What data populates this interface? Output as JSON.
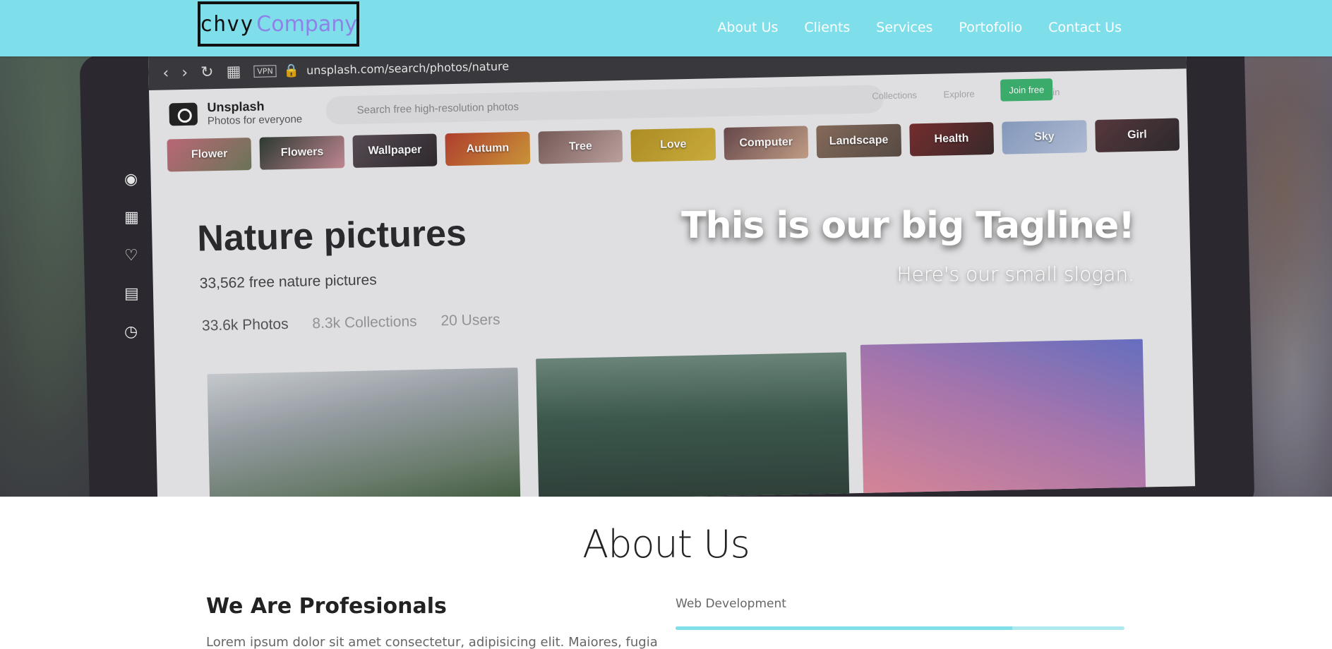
{
  "navbar": {
    "logo": {
      "part1": "chvy",
      "part2": "Company"
    },
    "links": [
      "About Us",
      "Clients",
      "Services",
      "Portofolio",
      "Contact Us"
    ]
  },
  "hero": {
    "tagline": "This is our big Tagline!",
    "slogan": "Here's our small slogan.",
    "screen": {
      "vpn": "VPN",
      "url": "unsplash.com/search/photos/nature",
      "brand": "Unsplash",
      "brand_sub": "Photos for everyone",
      "search_placeholder": "Search free high-resolution photos",
      "top_links": [
        "Collections",
        "Explore",
        "•••",
        "Login"
      ],
      "join": "Join free",
      "chips": [
        "Flower",
        "Flowers",
        "Wallpaper",
        "Autumn",
        "Tree",
        "Love",
        "Computer",
        "Landscape",
        "Health",
        "Sky",
        "Girl"
      ],
      "title": "Nature pictures",
      "count": "33,562 free nature pictures",
      "stats": {
        "photos": "33.6k Photos",
        "collections": "8.3k Collections",
        "users": "20 Users"
      }
    }
  },
  "about": {
    "heading": "About Us",
    "subheading": "We Are Profesionals",
    "text": "Lorem ipsum dolor sit amet consectetur, adipisicing elit. Maiores, fugiat? Minus",
    "skill": {
      "label": "Web Development",
      "percent": 75
    }
  },
  "colors": {
    "navbar": "#7edfea",
    "logo_accent": "#8d82e6",
    "progress": "#7edfea"
  },
  "icons": [
    "camera-icon",
    "grid-icon",
    "heart-icon",
    "news-icon",
    "clock-icon",
    "lock-icon",
    "search-icon"
  ]
}
